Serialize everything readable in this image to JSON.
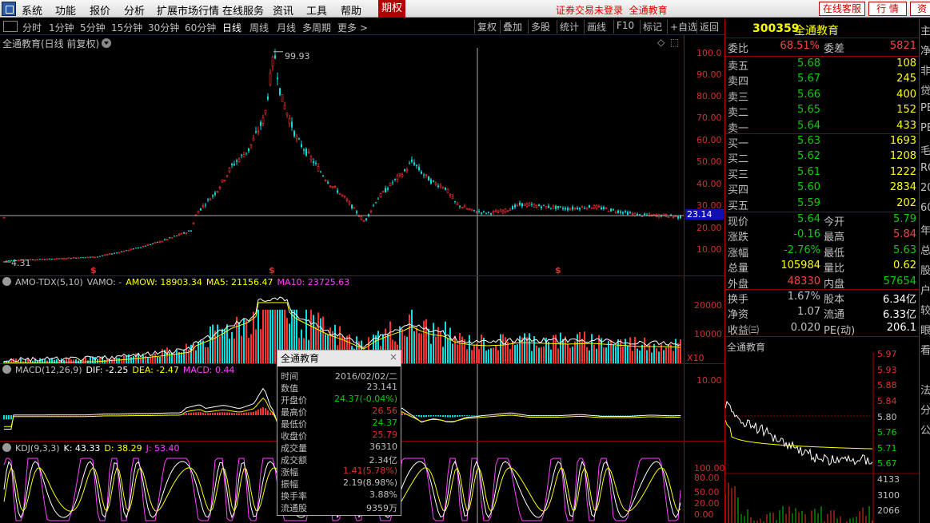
{
  "menubar": {
    "items": [
      "系统",
      "功能",
      "报价",
      "分析",
      "扩展市场行情",
      "在线服务",
      "资讯",
      "工具",
      "帮助"
    ],
    "qq_label": "期权",
    "login_text": "证券交易未登录",
    "login_link": "全通教育",
    "service_btn": "在线客服",
    "quote_btn": "行 情",
    "trade_btn": "资"
  },
  "toolbar": {
    "periods": [
      "分时",
      "1分钟",
      "5分钟",
      "15分钟",
      "30分钟",
      "60分钟",
      "日线",
      "周线",
      "月线",
      "多周期",
      "更多 >"
    ],
    "active": "日线",
    "right_items": [
      "复权",
      "叠加",
      "多股",
      "统计",
      "画线",
      "F10",
      "标记",
      "+自选",
      "返回"
    ]
  },
  "kline": {
    "title": "全通教育(日线 前复权)",
    "high_label": "99.93",
    "low_label": "4.31",
    "current_price": "23.14",
    "y_ticks": [
      "100.0",
      "90.00",
      "80.00",
      "70.00",
      "60.00",
      "50.00",
      "40.00",
      "30.00",
      "20.00",
      "10.00"
    ]
  },
  "volume": {
    "name": "AMO-TDX(5,10)",
    "vamo": "VAMO: -",
    "amow": "AMOW: 18903.34",
    "ma5": "MA5: 21156.47",
    "ma10": "MA10: 23725.63",
    "y_ticks": [
      "20000",
      "10000"
    ],
    "unit": "X10"
  },
  "macd": {
    "name": "MACD(12,26,9)",
    "dif": "DIF: -2.25",
    "dea": "DEA: -2.47",
    "macd": "MACD: 0.44",
    "y_ticks": [
      "10.00"
    ]
  },
  "kdj": {
    "name": "KDJ(9,3,3)",
    "k": "K: 43.33",
    "d": "D: 38.29",
    "j": "J: 53.40",
    "y_ticks": [
      "100.00",
      "80.00",
      "50.00",
      "20.00",
      "0.00"
    ]
  },
  "tooltip": {
    "title": "全通教育",
    "close": "×",
    "rows": [
      {
        "k": "时间",
        "v": "2016/02/02/二",
        "c": "#c0c0c0"
      },
      {
        "k": "数值",
        "v": "23.141",
        "c": "#c0c0c0"
      },
      {
        "k": "开盘价",
        "v": "24.37(-0.04%)",
        "c": "#00d000"
      },
      {
        "k": "最高价",
        "v": "26.56",
        "c": "#e03030"
      },
      {
        "k": "最低价",
        "v": "24.37",
        "c": "#00d000"
      },
      {
        "k": "收盘价",
        "v": "25.79",
        "c": "#e03030"
      },
      {
        "k": "成交量",
        "v": "36310",
        "c": "#c0c0c0"
      },
      {
        "k": "成交额",
        "v": "2.34亿",
        "c": "#c0c0c0"
      },
      {
        "k": "涨幅",
        "v": "1.41(5.78%)",
        "c": "#e03030"
      },
      {
        "k": "振幅",
        "v": "2.19(8.98%)",
        "c": "#c0c0c0"
      },
      {
        "k": "换手率",
        "v": "3.88%",
        "c": "#c0c0c0"
      },
      {
        "k": "流通股",
        "v": "9359万",
        "c": "#c0c0c0"
      }
    ]
  },
  "quote": {
    "code": "300359",
    "name": "全通教育",
    "weibi_label": "委比",
    "weibi": "68.51%",
    "weicha_label": "委差",
    "weicha": "5821",
    "sells": [
      {
        "l": "卖五",
        "p": "5.68",
        "v": "108"
      },
      {
        "l": "卖四",
        "p": "5.67",
        "v": "245"
      },
      {
        "l": "卖三",
        "p": "5.66",
        "v": "400"
      },
      {
        "l": "卖二",
        "p": "5.65",
        "v": "152"
      },
      {
        "l": "卖一",
        "p": "5.64",
        "v": "433"
      }
    ],
    "buys": [
      {
        "l": "买一",
        "p": "5.63",
        "v": "1693"
      },
      {
        "l": "买二",
        "p": "5.62",
        "v": "1208"
      },
      {
        "l": "买三",
        "p": "5.61",
        "v": "1222"
      },
      {
        "l": "买四",
        "p": "5.60",
        "v": "2834"
      },
      {
        "l": "买五",
        "p": "5.59",
        "v": "202"
      }
    ],
    "stats": [
      {
        "l1": "现价",
        "v1": "5.64",
        "c1": "#00d000",
        "l2": "今开",
        "v2": "5.79",
        "c2": "#00d000"
      },
      {
        "l1": "涨跌",
        "v1": "-0.16",
        "c1": "#00d000",
        "l2": "最高",
        "v2": "5.84",
        "c2": "#ff4040"
      },
      {
        "l1": "涨幅",
        "v1": "-2.76%",
        "c1": "#00d000",
        "l2": "最低",
        "v2": "5.63",
        "c2": "#00d000"
      },
      {
        "l1": "总量",
        "v1": "105984",
        "c1": "#ffff00",
        "l2": "量比",
        "v2": "0.62",
        "c2": "#ffff00"
      },
      {
        "l1": "外盘",
        "v1": "48330",
        "c1": "#ff4040",
        "l2": "内盘",
        "v2": "57654",
        "c2": "#00d000"
      }
    ],
    "fund": [
      {
        "l1": "换手",
        "v1": "1.67%",
        "l2": "股本",
        "v2": "6.34亿"
      },
      {
        "l1": "净资",
        "v1": "1.07",
        "l2": "流通",
        "v2": "6.33亿"
      },
      {
        "l1": "收益㈢",
        "v1": "0.020",
        "l2": "PE(动)",
        "v2": "206.1"
      }
    ]
  },
  "mini": {
    "title": "全通教育",
    "y_ticks": [
      {
        "t": "5.97",
        "c": "#e03030"
      },
      {
        "t": "5.93",
        "c": "#e03030"
      },
      {
        "t": "5.88",
        "c": "#e03030"
      },
      {
        "t": "5.84",
        "c": "#e03030"
      },
      {
        "t": "5.80",
        "c": "#c0c0c0"
      },
      {
        "t": "5.76",
        "c": "#00d000"
      },
      {
        "t": "5.71",
        "c": "#00d000"
      },
      {
        "t": "5.67",
        "c": "#00d000"
      },
      {
        "t": "4133",
        "c": "#c0c0c0"
      },
      {
        "t": "3100",
        "c": "#c0c0c0"
      },
      {
        "t": "2066",
        "c": "#c0c0c0"
      }
    ]
  },
  "far_right": [
    "主",
    "净",
    "非",
    "贷",
    "PE",
    "PE",
    "毛",
    "ROE",
    "20",
    "60",
    "年",
    "总",
    "股",
    "户",
    "较",
    "眼",
    "看",
    "",
    "法",
    "分",
    "公"
  ]
}
